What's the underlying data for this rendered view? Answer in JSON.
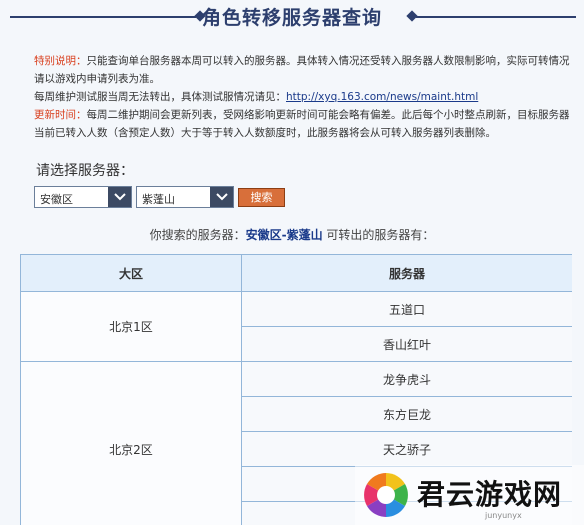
{
  "page": {
    "title": "角色转移服务器查询"
  },
  "notes": {
    "special_label": "特别说明：",
    "special_text": "只能查询单台服务器本周可以转入的服务器。具体转入情况还受转入服务器人数限制影响，实际可转情况请以游戏内申请列表为准。",
    "maintenance_text": "每周维护测试服当周无法转出，具体测试服情况请见：",
    "maintenance_link": "http://xyq.163.com/news/maint.html",
    "update_label": "更新时间：",
    "update_text": "每周二维护期间会更新列表，受网络影响更新时间可能会略有偏差。此后每个小时整点刷新，目标服务器当前已转入人数（含预定人数）大于等于转入人数额度时，此服务器将会从可转入服务器列表删除。"
  },
  "form": {
    "prompt": "请选择服务器：",
    "region_value": "安徽区",
    "server_value": "紫蓬山",
    "search_label": "搜索"
  },
  "result": {
    "prefix": "你搜索的服务器：",
    "server": "安徽区-紫蓬山",
    "suffix": " 可转出的服务器有："
  },
  "table": {
    "headers": [
      "大区",
      "服务器"
    ],
    "groups": [
      {
        "region": "北京1区",
        "servers": [
          "五道口",
          "香山红叶"
        ]
      },
      {
        "region": "北京2区",
        "servers": [
          "龙争虎斗",
          "东方巨龙",
          "天之骄子",
          "",
          ""
        ]
      }
    ]
  },
  "watermark": {
    "text": "君云游戏网",
    "sub": "junyunyx"
  },
  "colors": {
    "title": "#2d3f6e",
    "label_red": "#d9401f",
    "link": "#1a3a8a",
    "button": "#d86f3a",
    "table_border": "#93b6d9"
  }
}
